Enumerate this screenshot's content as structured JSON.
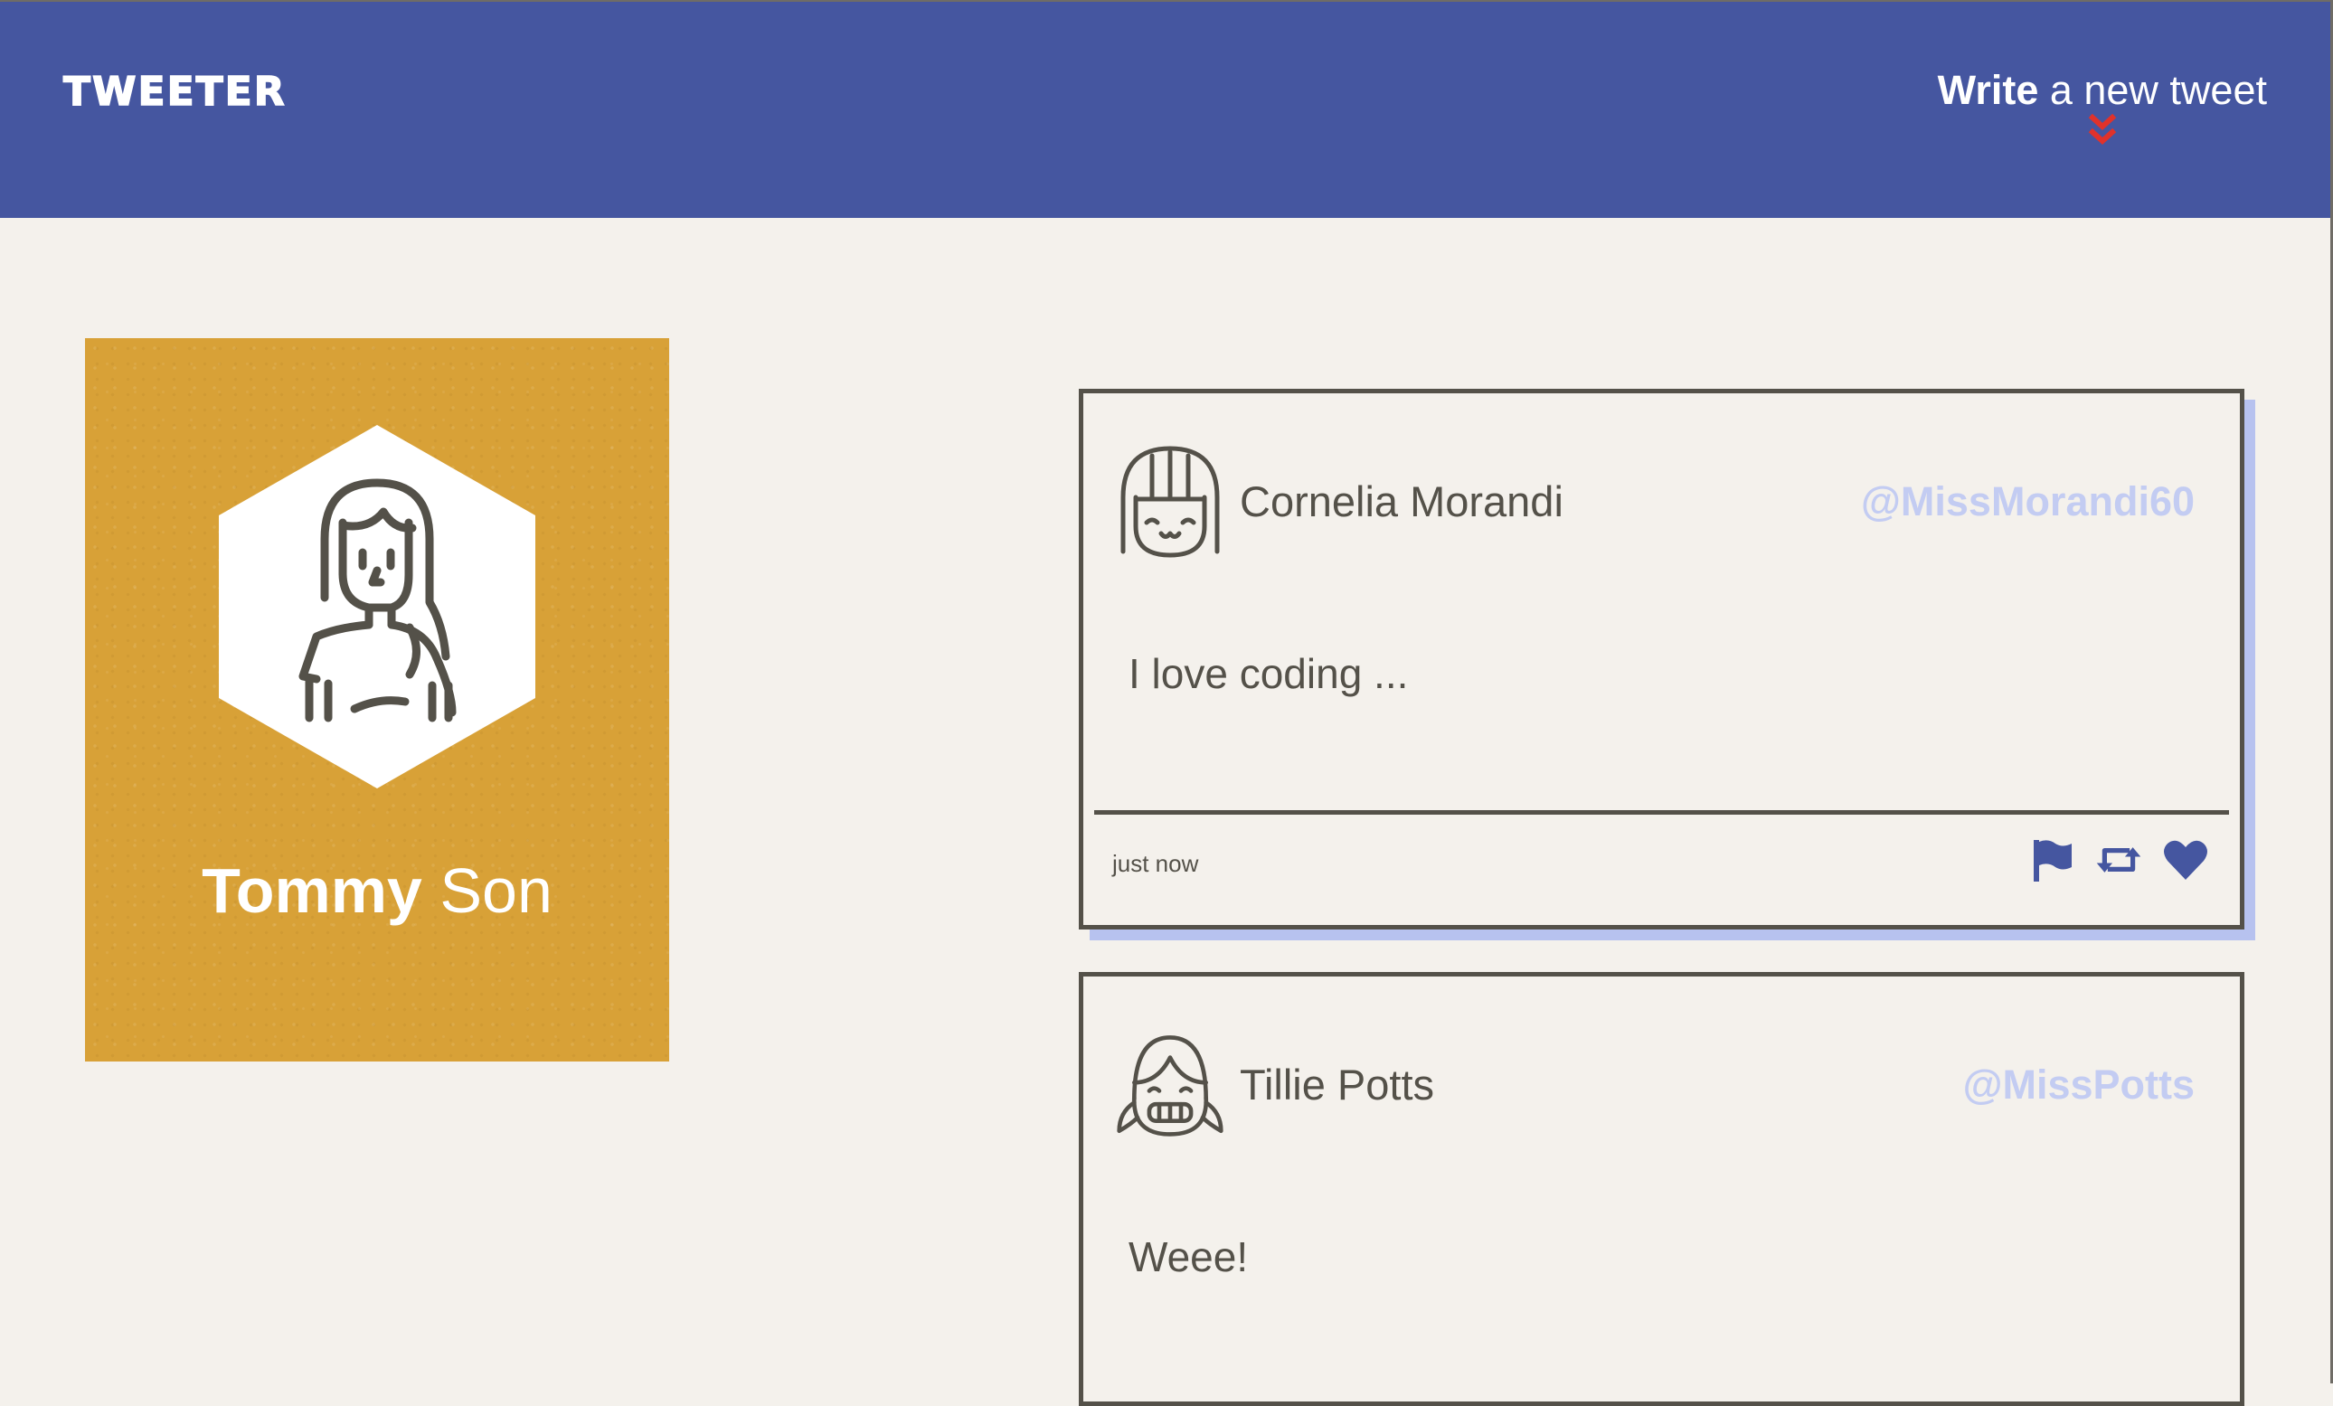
{
  "nav": {
    "logo": "TWEETER",
    "compose_strong": "Write",
    "compose_light": " a new tweet",
    "compose_icon": "double-chevron-down-icon"
  },
  "profile": {
    "first_name": "Tommy",
    "last_name": " Son",
    "avatar_icon": "woman-avatar-icon"
  },
  "tweets": [
    {
      "name": "Cornelia Morandi",
      "handle": "@MissMorandi60",
      "content": "I love coding ...",
      "time": "just now",
      "avatar_icon": "girl-bangs-avatar-icon",
      "actions": [
        "flag-icon",
        "retweet-icon",
        "heart-icon"
      ]
    },
    {
      "name": "Tillie Potts",
      "handle": "@MissPotts",
      "content": "Weee!",
      "avatar_icon": "girl-pigtails-avatar-icon"
    }
  ],
  "colors": {
    "nav_bg": "#4556a0",
    "page_bg": "#f4f1ec",
    "profile_bg": "#d8a137",
    "accent_red": "#e0322b",
    "handle": "#c3ccf2",
    "shadow": "#b7c2ef",
    "text": "#545149",
    "icon_blue": "#4556a0"
  }
}
